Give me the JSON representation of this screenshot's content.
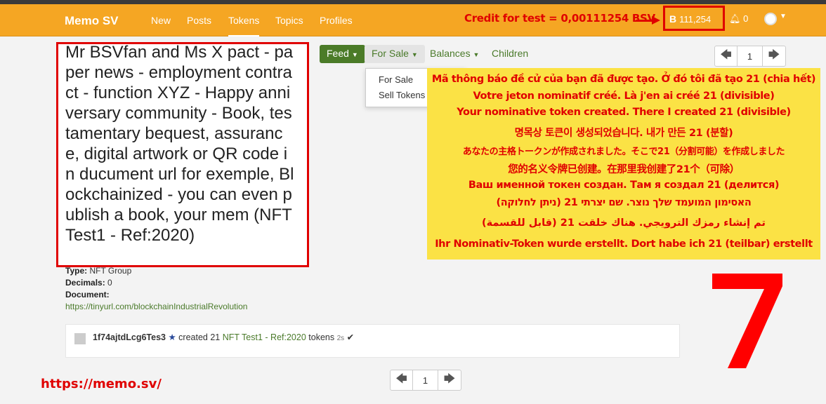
{
  "navbar": {
    "brand": "Memo SV",
    "items": [
      "New",
      "Posts",
      "Tokens",
      "Topics",
      "Profiles"
    ],
    "active": "Tokens",
    "balance_icon": "B",
    "balance": "111,254",
    "notifications": "0"
  },
  "annotations": {
    "credit": "Credit for test = 0,00111254 BSV",
    "footer_url": "https://memo.sv/",
    "big_number": "7"
  },
  "token": {
    "title": "Mr BSVfan and Ms X pact - paper news - employment contract - function XYZ - Happy anniversary community - Book, testamentary bequest, assurance, digital artwork or QR code in ducument url for exemple, Blockchainized - you can even publish a book, your mem (NFT Test1 - Ref:2020)",
    "type_label": "Type:",
    "type_value": "NFT Group",
    "decimals_label": "Decimals:",
    "decimals_value": "0",
    "document_label": "Document:",
    "document_url": "https://tinyurl.com/blockchainIndustrialRevolution"
  },
  "tabs": {
    "feed": "Feed",
    "for_sale": "For Sale",
    "balances": "Balances",
    "children": "Children",
    "dropdown": [
      "For Sale",
      "Sell Tokens"
    ]
  },
  "pager": {
    "page": "1"
  },
  "translations": [
    "Mã thông báo đề cử của bạn đã được tạo. Ở đó tôi đã tạo 21 (chia hết)",
    "Votre jeton nominatif créé. Là j'en ai créé 21 (divisible)",
    "Your nominative token created. There I created 21 (divisible)",
    "명목상 토큰이 생성되었습니다. 내가 만든 21 (분할)",
    "あなたの主格トークンが作成されました。そこで21（分割可能）を作成しました",
    "您的名义令牌已创建。在那里我创建了21个（可除）",
    "Ваш именной токен создан. Там я создал 21 (делится)",
    "האסימון המועמד שלך נוצר. שם יצרתי 21 (ניתן לחלוקה)",
    "تم إنشاء رمزك الترويجي. هناك خلقت 21 (قابل للقسمة)",
    "Ihr Nominativ-Token wurde erstellt. Dort habe ich 21 (teilbar) erstellt"
  ],
  "activity": {
    "address": "1f74ajtdLcg6Tes3",
    "star": "★",
    "action": "created 21",
    "token_link": "NFT Test1 - Ref:2020",
    "suffix": "tokens",
    "ago": "2s",
    "check": "✔"
  }
}
